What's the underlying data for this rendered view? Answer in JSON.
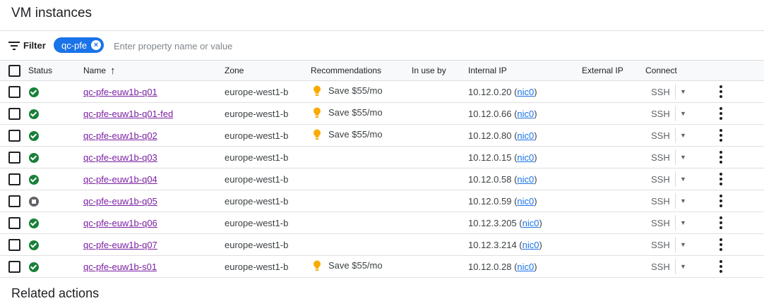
{
  "header": {
    "title": "VM instances"
  },
  "filter": {
    "label": "Filter",
    "chip": "qc-pfe",
    "chip_close": "×",
    "placeholder": "Enter property name or value"
  },
  "table": {
    "columns": {
      "status": "Status",
      "name": "Name",
      "zone": "Zone",
      "recommendations": "Recommendations",
      "in_use_by": "In use by",
      "internal_ip": "Internal IP",
      "external_ip": "External IP",
      "connect": "Connect"
    },
    "sort": "ascending",
    "rows": [
      {
        "status": "running",
        "name": "qc-pfe-euw1b-q01",
        "zone": "europe-west1-b",
        "recommendation": "Save $55/mo",
        "ip": "10.12.0.20",
        "nic": "nic0",
        "connect": "SSH"
      },
      {
        "status": "running",
        "name": "qc-pfe-euw1b-q01-fed",
        "zone": "europe-west1-b",
        "recommendation": "Save $55/mo",
        "ip": "10.12.0.66",
        "nic": "nic0",
        "connect": "SSH"
      },
      {
        "status": "running",
        "name": "qc-pfe-euw1b-q02",
        "zone": "europe-west1-b",
        "recommendation": "Save $55/mo",
        "ip": "10.12.0.80",
        "nic": "nic0",
        "connect": "SSH"
      },
      {
        "status": "running",
        "name": "qc-pfe-euw1b-q03",
        "zone": "europe-west1-b",
        "recommendation": "",
        "ip": "10.12.0.15",
        "nic": "nic0",
        "connect": "SSH"
      },
      {
        "status": "running",
        "name": "qc-pfe-euw1b-q04",
        "zone": "europe-west1-b",
        "recommendation": "",
        "ip": "10.12.0.58",
        "nic": "nic0",
        "connect": "SSH"
      },
      {
        "status": "stopped",
        "name": "qc-pfe-euw1b-q05",
        "zone": "europe-west1-b",
        "recommendation": "",
        "ip": "10.12.0.59",
        "nic": "nic0",
        "connect": "SSH"
      },
      {
        "status": "running",
        "name": "qc-pfe-euw1b-q06",
        "zone": "europe-west1-b",
        "recommendation": "",
        "ip": "10.12.3.205",
        "nic": "nic0",
        "connect": "SSH"
      },
      {
        "status": "running",
        "name": "qc-pfe-euw1b-q07",
        "zone": "europe-west1-b",
        "recommendation": "",
        "ip": "10.12.3.214",
        "nic": "nic0",
        "connect": "SSH"
      },
      {
        "status": "running",
        "name": "qc-pfe-euw1b-s01",
        "zone": "europe-west1-b",
        "recommendation": "Save $55/mo",
        "ip": "10.12.0.28",
        "nic": "nic0",
        "connect": "SSH"
      }
    ]
  },
  "related": {
    "title": "Related actions"
  },
  "colors": {
    "status_ok": "#188038",
    "status_stopped": "#5f6368",
    "link": "#1a73e8",
    "visited_link": "#7b1fa2",
    "bulb": "#f9ab00",
    "chip": "#1a73e8"
  },
  "icons": {
    "filter": "filter-lines-icon",
    "sort": "arrow-up-icon",
    "recommendation": "lightbulb-icon",
    "running": "check-circle-icon",
    "stopped": "stop-circle-icon",
    "more": "more-vert-icon"
  }
}
